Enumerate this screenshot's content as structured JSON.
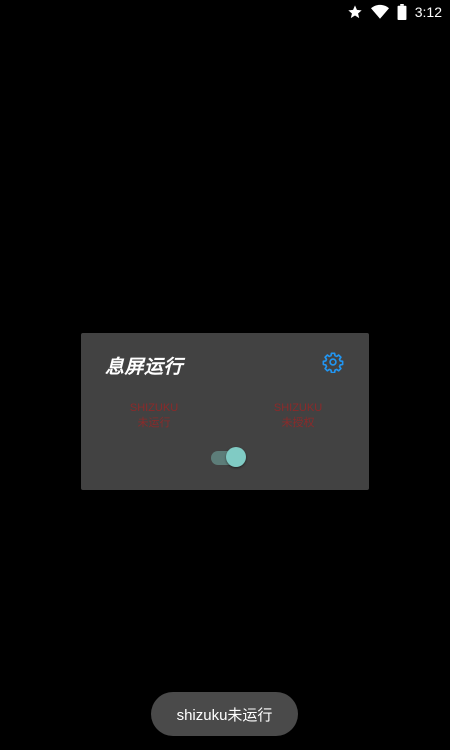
{
  "status_bar": {
    "icons": [
      "star-icon",
      "wifi-icon",
      "battery-icon"
    ],
    "time": "3:12"
  },
  "dialog": {
    "title": "息屏运行",
    "settings_icon": "gear-icon",
    "status_left": {
      "line1": "SHIZUKU",
      "line2": "未运行"
    },
    "status_right": {
      "line1": "SHIZUKU",
      "line2": "未授权"
    },
    "switch_on": true
  },
  "toast": {
    "message": "shizuku未运行"
  },
  "colors": {
    "background": "#000000",
    "dialog_bg": "#424242",
    "accent_blue": "#2196f3",
    "warning_red": "#8b2a2a",
    "switch_thumb": "#80cbc4",
    "switch_track": "#5d7d79"
  }
}
